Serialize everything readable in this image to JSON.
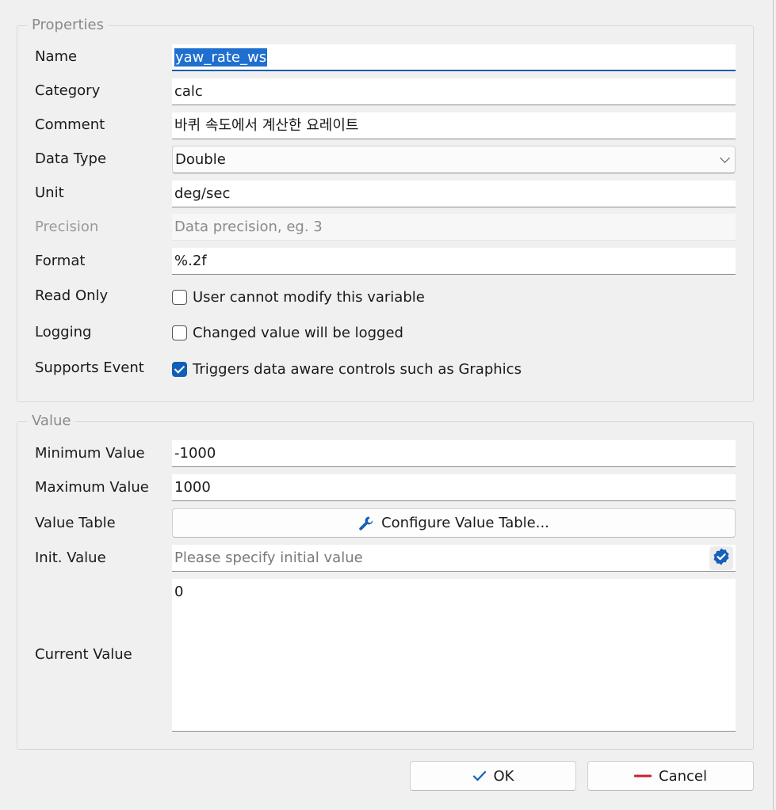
{
  "properties": {
    "title": "Properties",
    "name": {
      "label": "Name",
      "value": "yaw_rate_ws"
    },
    "category": {
      "label": "Category",
      "value": "calc"
    },
    "comment": {
      "label": "Comment",
      "value": "바퀴 속도에서 계산한 요레이트"
    },
    "data_type": {
      "label": "Data Type",
      "value": "Double"
    },
    "unit": {
      "label": "Unit",
      "value": "deg/sec"
    },
    "precision": {
      "label": "Precision",
      "placeholder": "Data precision, eg. 3"
    },
    "format": {
      "label": "Format",
      "value": "%.2f"
    },
    "read_only": {
      "label": "Read Only",
      "text": "User cannot modify this variable",
      "checked": false
    },
    "logging": {
      "label": "Logging",
      "text": "Changed value will be logged",
      "checked": false
    },
    "supports_event": {
      "label": "Supports Event",
      "text": "Triggers data aware controls such as Graphics",
      "checked": true
    }
  },
  "value": {
    "title": "Value",
    "minimum": {
      "label": "Minimum Value",
      "value": "-1000"
    },
    "maximum": {
      "label": "Maximum Value",
      "value": "1000"
    },
    "value_table": {
      "label": "Value Table",
      "button": "Configure Value Table..."
    },
    "init": {
      "label": "Init. Value",
      "placeholder": "Please specify initial value"
    },
    "current": {
      "label": "Current Value",
      "value": "0"
    }
  },
  "buttons": {
    "ok": "OK",
    "cancel": "Cancel"
  },
  "icons": {
    "data_type_dropdown": "chevron-down-icon",
    "configure_value_table": "wrench-icon",
    "init_value_verify": "verified-badge-icon",
    "ok": "checkmark-icon",
    "cancel": "dash-icon"
  },
  "colors": {
    "accent": "#0f5fb8",
    "selection": "#1e6fd0",
    "cancel_icon": "#d0202a"
  }
}
